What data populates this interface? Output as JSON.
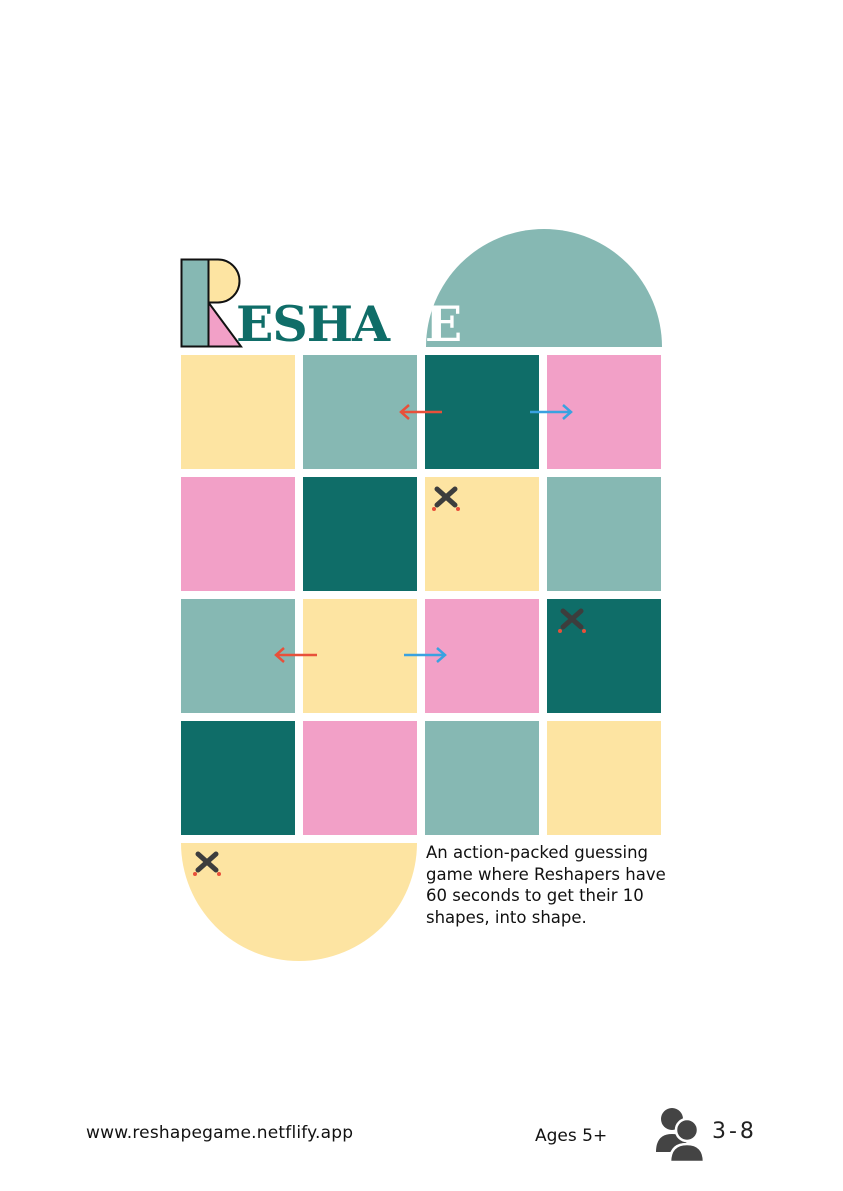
{
  "title": {
    "initial_letter": "R",
    "word_dark": "ESHA",
    "word_white": "PE"
  },
  "description": "An action-packed guessing game where Reshapers have 60 seconds to get their 10 shapes, into shape.",
  "footer": {
    "url": "www.reshapegame.netflify.app",
    "ages": "Ages 5+",
    "players": "3-8",
    "players_icon": "people-icon"
  },
  "colors": {
    "dark_teal": "#0f6d68",
    "light_teal": "#86b8b3",
    "yellow": "#fde4a2",
    "pink": "#f2a0c7",
    "arrow_left": "#e8503a",
    "arrow_right": "#3aa2e0",
    "sword_icon": "#3d3d3d"
  },
  "board": {
    "rows": [
      [
        "yellow",
        "light_teal",
        "dark_teal",
        "pink"
      ],
      [
        "pink",
        "dark_teal",
        "yellow",
        "light_teal"
      ],
      [
        "light_teal",
        "yellow",
        "pink",
        "dark_teal"
      ],
      [
        "dark_teal",
        "pink",
        "light_teal",
        "yellow"
      ]
    ],
    "icons": [
      "arrow-left-icon",
      "arrow-right-icon",
      "crossed-swords-icon"
    ]
  }
}
